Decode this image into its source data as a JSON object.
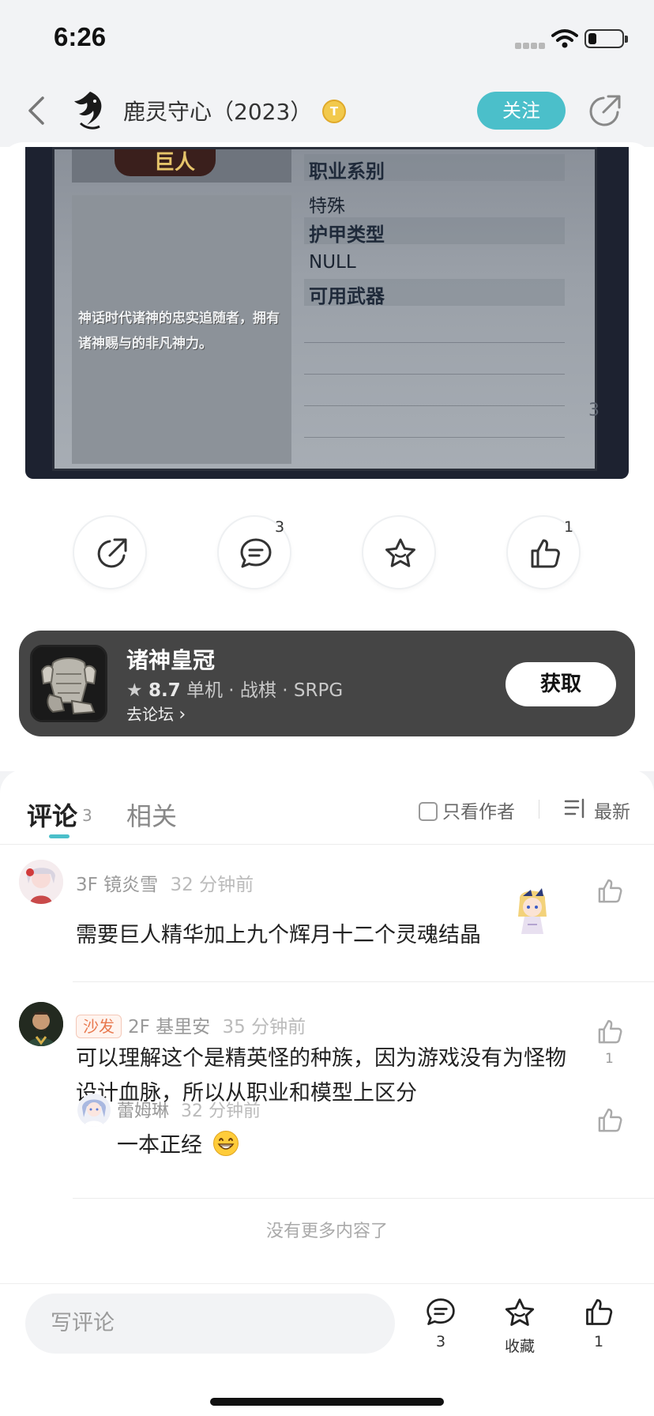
{
  "status_bar": {
    "time": "6:26",
    "battery_level": 0.25
  },
  "nav": {
    "title": "鹿灵守心（2023）",
    "badge": "T",
    "follow_label": "关注"
  },
  "game_image": {
    "header": "巨人",
    "description": "神话时代诸神的忠实追随者，拥有诸神赐与的非凡神力。",
    "labels": [
      "职业系别",
      "特殊",
      "护甲类型",
      "NULL",
      "可用武器"
    ],
    "corner_text": "3"
  },
  "actions": {
    "comment_count": "3",
    "like_count": "1"
  },
  "game_card": {
    "name": "诸神皇冠",
    "rating": "8.7",
    "tags": "单机 · 战棋 · SRPG",
    "forum_link": "去论坛",
    "get_label": "获取"
  },
  "comments_header": {
    "tab_comments": "评论",
    "tab_comments_count": "3",
    "tab_related": "相关",
    "author_only": "只看作者",
    "sort_label": "最新"
  },
  "comments": [
    {
      "floor_user": "3F 镜炎雪",
      "time": "32 分钟前",
      "text": "需要巨人精华加上九个辉月十二个灵魂结晶"
    },
    {
      "tag": "沙发",
      "floor_user": "2F 基里安",
      "time": "35 分钟前",
      "text": "可以理解这个是精英怪的种族，因为游戏没有为怪物设计血脉，所以从职业和模型上区分",
      "likes": "1"
    },
    {
      "user": "蕾姆琳",
      "time": "32 分钟前",
      "text": "一本正经"
    }
  ],
  "no_more_text": "没有更多内容了",
  "bottom_bar": {
    "input_placeholder": "写评论",
    "comment_count": "3",
    "collect_label": "收藏",
    "like_count": "1"
  }
}
